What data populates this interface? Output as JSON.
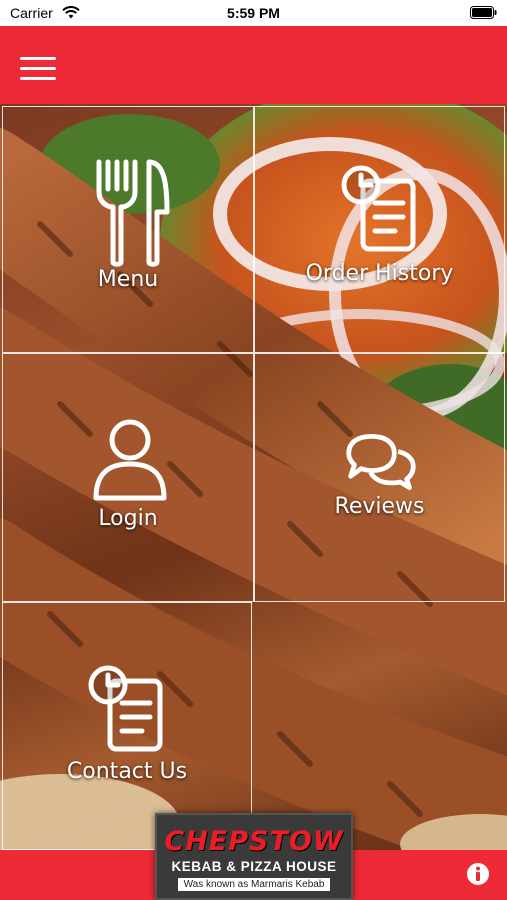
{
  "status_bar": {
    "carrier": "Carrier",
    "time": "5:59 PM",
    "icons": [
      "wifi-icon",
      "battery-icon"
    ]
  },
  "header": {
    "menu_icon": "hamburger-menu-icon",
    "color": "#ee2a36"
  },
  "tiles": [
    {
      "label": "Menu",
      "icon": "fork-knife-icon"
    },
    {
      "label": "Order History",
      "icon": "order-history-icon"
    },
    {
      "label": "Login",
      "icon": "user-icon"
    },
    {
      "label": "Reviews",
      "icon": "chat-bubbles-icon"
    },
    {
      "label": "Contact Us",
      "icon": "contact-clipboard-icon"
    }
  ],
  "footer": {
    "info_icon": "info-icon",
    "color": "#ee2a36"
  },
  "logo": {
    "name": "CHEPSTOW",
    "subtitle": "KEBAB & PIZZA HOUSE",
    "note": "Was known as Marmaris Kebab"
  }
}
